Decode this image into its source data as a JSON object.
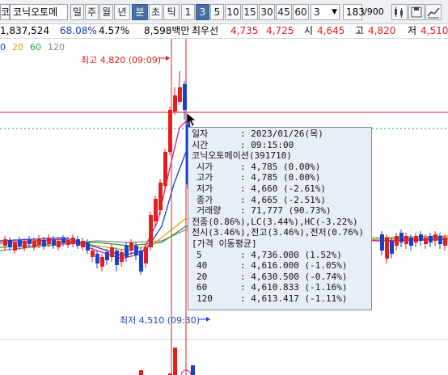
{
  "toolbar": {
    "stock_prefix": "코",
    "stock_name": "코닉오토메",
    "periods": [
      "일",
      "주",
      "월",
      "년",
      "분",
      "초",
      "틱"
    ],
    "active_period": "분",
    "intervals": [
      "1",
      "3",
      "5",
      "10",
      "15",
      "30",
      "45",
      "60"
    ],
    "active_interval": "3",
    "interval_select": "3",
    "count_value": "183",
    "count_total": "/900"
  },
  "inforow": {
    "volume": "1,837,524",
    "ratio": "68.08%",
    "change": "4.57%",
    "amount": "8,598백만",
    "best_sell_label": "최우선",
    "best_sell": "4,735",
    "best_buy": "4,725",
    "open_label": "시",
    "open": "4,645",
    "high_label": "고",
    "high": "4,820",
    "low_label": "저",
    "low": "4,510"
  },
  "ma_legend": [
    "0",
    "20",
    "60",
    "120"
  ],
  "colors": {
    "up": "#e0201c",
    "down": "#1a3fc8",
    "ma5": "#d81c8a",
    "ma20": "#e0a010",
    "ma60": "#2a9a40",
    "ma120": "#888888"
  },
  "markers": {
    "high_label": "최고 4,820 (09:09)",
    "low_label": "최저 4,510 (09:30)"
  },
  "tooltip": {
    "date_label": "일자",
    "date": ": 2023/01/26(목)",
    "time_label": "시간",
    "time": ": 09:15:00",
    "stock": "코닉오토메이션(391710)",
    "open_label": "시가",
    "open": ": 4,785 (0.00%)",
    "high_label": "고가",
    "high": ": 4,785 (0.00%)",
    "low_label": "저가",
    "low": ": 4,660 (-2.61%)",
    "close_label": "종가",
    "close": ": 4,665 (-2.51%)",
    "volume_label": "거래량",
    "volume": ": 71,777 (90.73%)",
    "line1": "전종(0.86%),LC(3.44%),HC(-3.22%)",
    "line2": "전시(3.46%),전고(3.46%),전저(0.76%)",
    "ma_header": "[가격 이동평균]",
    "ma": [
      {
        "period": "5",
        "value": ": 4,736.000 (1.52%)"
      },
      {
        "period": "40",
        "value": ": 4,616.000 (-1.05%)"
      },
      {
        "period": "20",
        "value": ": 4,630.500 (-0.74%)"
      },
      {
        "period": "60",
        "value": ": 4,610.833 (-1.16%)"
      },
      {
        "period": "120",
        "value": ": 4,613.417 (-1.11%)"
      }
    ]
  }
}
